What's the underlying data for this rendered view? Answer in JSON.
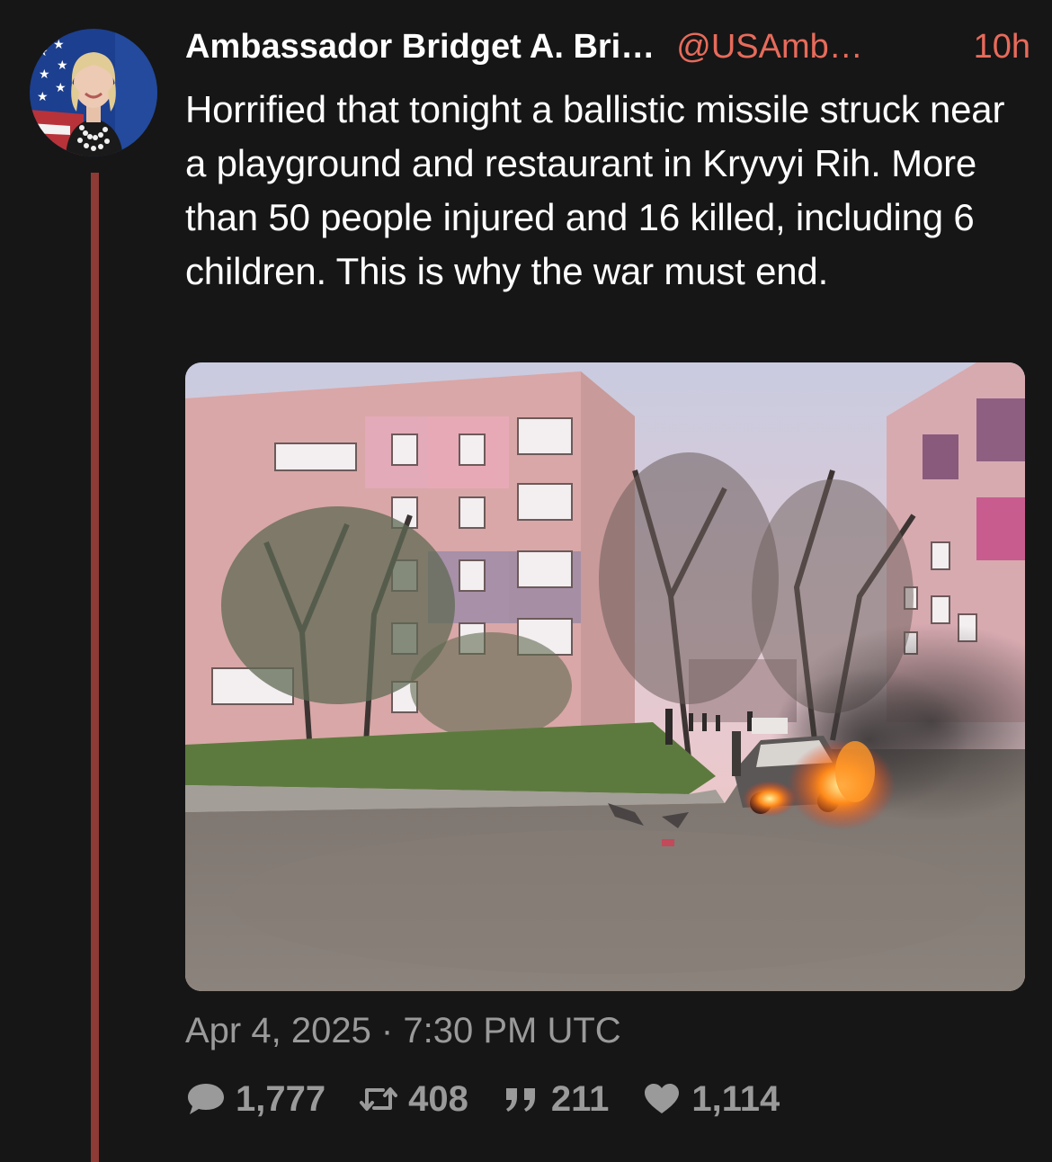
{
  "tweet": {
    "author_name": "Ambassador Bridget A. Bri…",
    "author_handle": "@USAmb…",
    "time_ago": "10h",
    "text": "Horrified that tonight a ballistic missile struck near a playground and restaurant in Kryvyi Rih. More than 50 people injured and 16 killed, including 6 children. This is why the war must end.",
    "timestamp": "Apr 4, 2025 · 7:30 PM UTC"
  },
  "actions": {
    "replies": "1,777",
    "retweets": "408",
    "quotes": "211",
    "likes": "1,114"
  },
  "icons": {
    "reply": "speech-bubble-icon",
    "retweet": "retweet-icon",
    "quote": "quote-icon",
    "like": "heart-icon"
  },
  "colors": {
    "background": "#161616",
    "accent": "#e76b5b",
    "thread_line": "#8e3a35",
    "muted": "#9a9a9a"
  }
}
